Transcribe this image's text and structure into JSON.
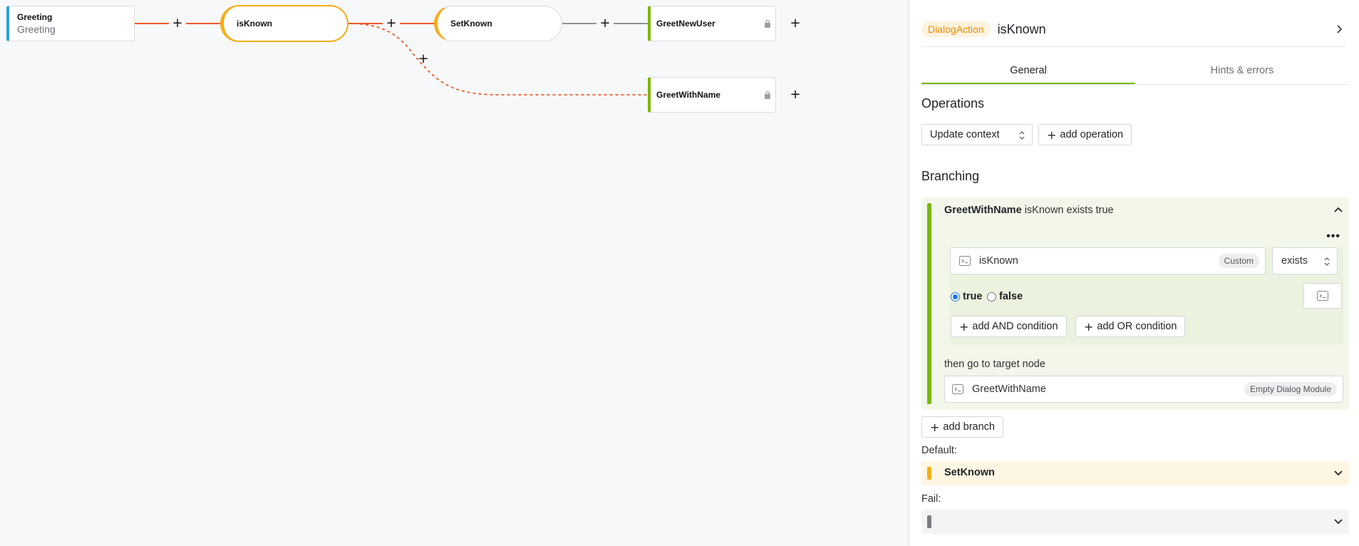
{
  "canvas": {
    "nodes": [
      {
        "id": "greeting",
        "title": "Greeting",
        "subtitle": "Greeting"
      },
      {
        "id": "isknown",
        "title": "isKnown"
      },
      {
        "id": "setknown",
        "title": "SetKnown"
      },
      {
        "id": "greetnewuser",
        "title": "GreetNewUser"
      },
      {
        "id": "greetwithname",
        "title": "GreetWithName"
      }
    ],
    "edge_colors": {
      "active": "#f05a28",
      "inactive": "#555555"
    }
  },
  "panel": {
    "badge": "DialogAction",
    "title": "isKnown",
    "tabs": [
      "General",
      "Hints & errors"
    ],
    "active_tab": "General",
    "operations": {
      "heading": "Operations",
      "select_value": "Update context",
      "add_label": "add operation"
    },
    "branching": {
      "heading": "Branching",
      "branch": {
        "target": "GreetWithName",
        "summary": "isKnown exists true",
        "field_value": "isKnown",
        "field_tag": "Custom",
        "operator": "exists",
        "radio_true": "true",
        "radio_false": "false",
        "add_and": "add AND condition",
        "add_or": "add OR condition",
        "then_label": "then go to target node",
        "target_value": "GreetWithName",
        "target_tag": "Empty Dialog Module"
      },
      "add_branch": "add branch",
      "default_label": "Default:",
      "default_value": "SetKnown",
      "fail_label": "Fail:",
      "fail_value": ""
    },
    "colors": {
      "accent": "#7ab800",
      "warn": "#f6ad17",
      "badge_text": "#f08a00"
    }
  }
}
